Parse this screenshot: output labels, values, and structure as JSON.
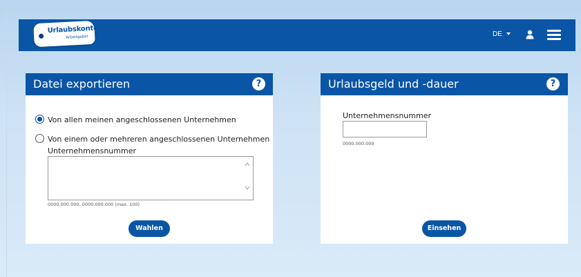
{
  "header": {
    "logo_brand": "Urlaubskonto",
    "logo_sub": "Arbeitgeber",
    "language": "DE",
    "icons": [
      "user-icon",
      "menu-icon"
    ],
    "bar_color": "#0a55a6"
  },
  "export_card": {
    "title": "Datei exportieren",
    "help_label": "?",
    "option_all": "Von allen meinen angeschlossenen Unternehmen",
    "option_some": "Von einem oder mehreren angeschlossenen Unternehmen",
    "selected_option": "option_all",
    "field_label": "Unternehmensnummer",
    "field_value": "",
    "field_hint": "0000.000.000; 0000.000.000 (max. 100)",
    "button_label": "Wahlen"
  },
  "vacation_card": {
    "title": "Urlaubsgeld und -dauer",
    "help_label": "?",
    "field_label": "Unternehmensnummer",
    "field_value": "",
    "field_hint": "0000.000.000",
    "button_label": "Einsehen"
  }
}
